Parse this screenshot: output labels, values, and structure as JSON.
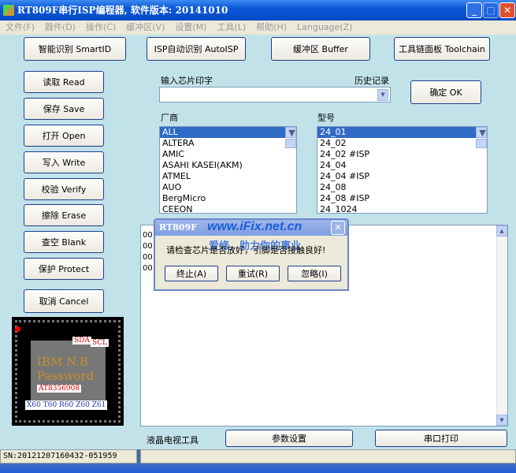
{
  "window": {
    "title": "RT809F串行ISP编程器, 软件版本: 20141010"
  },
  "menu": [
    "文件(F)",
    "器件(D)",
    "操作(C)",
    "缓冲区(V)",
    "设置(M)",
    "工具(L)",
    "帮助(H)",
    "Language(Z)"
  ],
  "top_buttons": [
    "智能识别 SmartID",
    "ISP自动识别 AutoISP",
    "缓冲区 Buffer",
    "工具链面板 Toolchain"
  ],
  "left_buttons": [
    "读取 Read",
    "保存 Save",
    "打开 Open",
    "写入 Write",
    "校验 Verify",
    "擦除 Erase",
    "查空 Blank",
    "保护 Protect",
    "取消 Cancel"
  ],
  "chip_input": {
    "label": "输入芯片印字",
    "value": "",
    "history_label": "历史记录"
  },
  "ok_button": "确定 OK",
  "vendor": {
    "label": "厂商",
    "items": [
      "ALL",
      "ALTERA",
      "AMIC",
      "ASAHI KASEI(AKM)",
      "ATMEL",
      "AUO",
      "BergMicro",
      "CEEON"
    ],
    "selected": "ALL"
  },
  "model": {
    "label": "型号",
    "items": [
      "24_01",
      "24_02",
      "24_02 #ISP",
      "24_04",
      "24_04 #ISP",
      "24_08",
      "24_08 #ISP",
      "24_1024"
    ],
    "selected": "24_01"
  },
  "log_lines": [
    "00",
    "00",
    "00",
    "00"
  ],
  "dialog": {
    "title": "RT809F",
    "watermark1": "www.iFix.net.cn",
    "watermark2": "爱修，助力你的事业",
    "message": "请检查芯片是否放好，引脚是否接触良好!",
    "buttons": [
      "终止(A)",
      "重试(R)",
      "忽略(I)"
    ]
  },
  "chip_image": {
    "sda": "SDA",
    "scl": "SCL",
    "line1": "IBM N.B",
    "line2": "Password",
    "part": "AT8356908",
    "models": "X60 T60 R60 Z60 Z61"
  },
  "bottom": {
    "label": "液晶电视工具",
    "params_button": "参数设置",
    "serial_button": "串口打印"
  },
  "status": {
    "sn": "SN:20121207160432-051959",
    "info": ""
  }
}
